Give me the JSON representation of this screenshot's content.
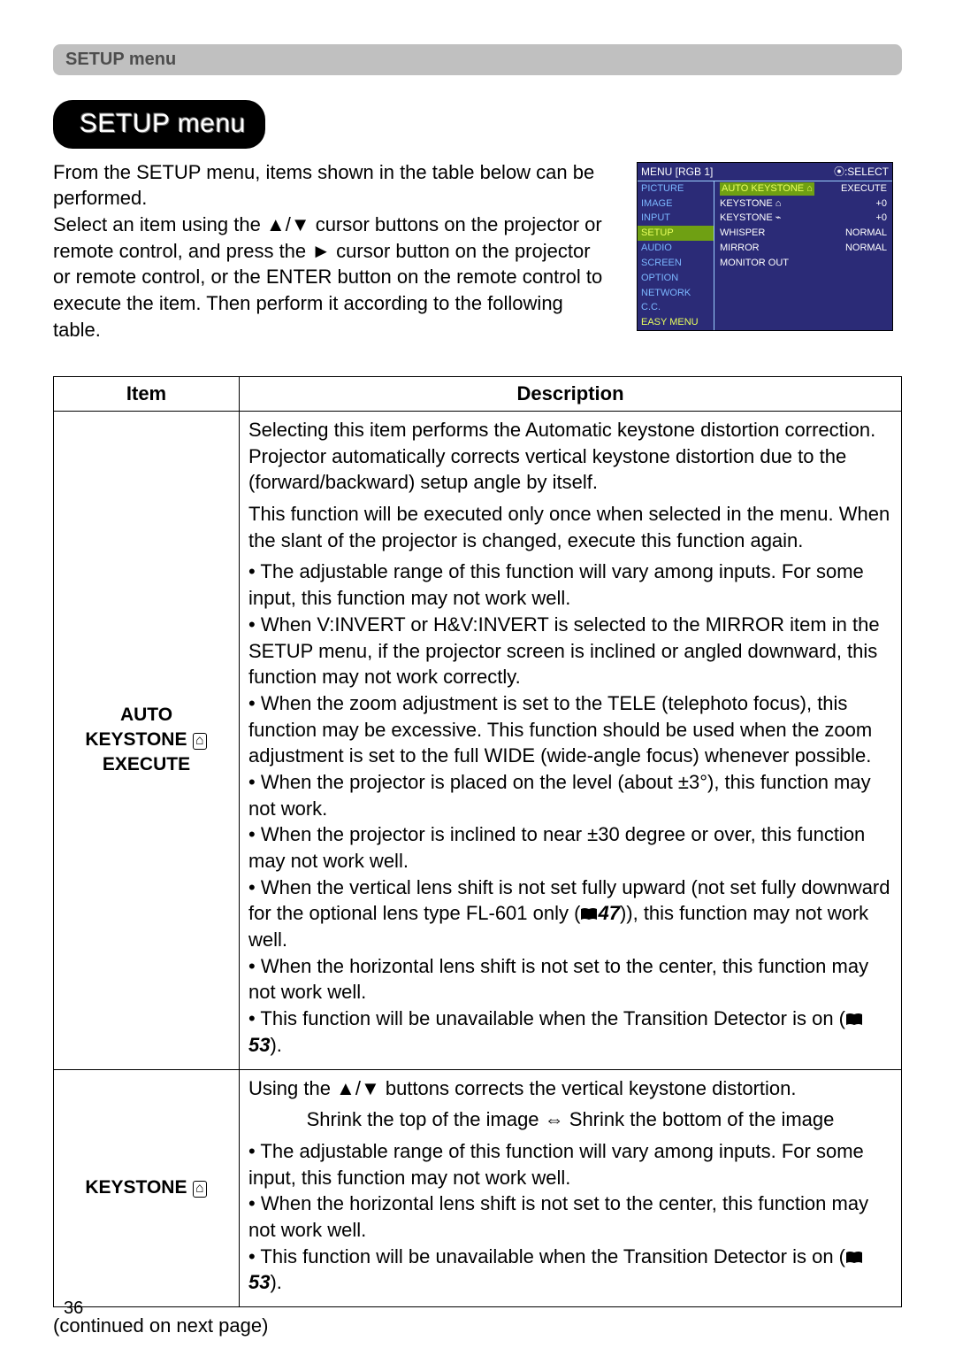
{
  "header": {
    "label": "SETUP menu"
  },
  "title": "SETUP menu",
  "intro": {
    "text_lines": [
      "From the SETUP menu, items shown in the table below can be performed.",
      "Select an item using the ▲/▼ cursor buttons on the projector or remote control, and press the ► cursor button on the projector or remote control, or the ENTER button on the remote control to execute the item. Then perform it according to the following table."
    ]
  },
  "menu_screenshot": {
    "head_left": "MENU [RGB 1]",
    "head_right": "⦿:SELECT",
    "sidebar": [
      {
        "label": "PICTURE"
      },
      {
        "label": "IMAGE"
      },
      {
        "label": "INPUT"
      },
      {
        "label": "SETUP",
        "selected": true
      },
      {
        "label": "AUDIO"
      },
      {
        "label": "SCREEN"
      },
      {
        "label": "OPTION"
      },
      {
        "label": "NETWORK"
      },
      {
        "label": "C.C."
      },
      {
        "label": "EASY MENU",
        "easy": true
      }
    ],
    "main_rows": [
      {
        "label": "AUTO KEYSTONE ⌂",
        "value": "EXECUTE",
        "selected": true
      },
      {
        "label": "KEYSTONE ⌂",
        "value": "+0"
      },
      {
        "label": "KEYSTONE ⌁",
        "value": "+0"
      },
      {
        "label": "WHISPER",
        "value": "NORMAL"
      },
      {
        "label": "MIRROR",
        "value": "NORMAL"
      },
      {
        "label": "MONITOR OUT",
        "value": ""
      }
    ]
  },
  "table": {
    "headers": {
      "item": "Item",
      "description": "Description"
    },
    "rows": [
      {
        "item_lines": [
          "AUTO",
          "KEYSTONE ",
          "EXECUTE"
        ],
        "item_icon": "trapezoid-v",
        "desc_p1": "Selecting this item performs the Automatic keystone distortion correction. Projector automatically corrects vertical keystone distortion due to the (forward/backward) setup angle by itself.",
        "desc_p2": "This function will be executed only once when selected in the menu. When the slant of the projector is changed, execute this function again.",
        "bullets": [
          "The adjustable range of this function will vary among inputs. For some input, this function may not work well.",
          "When V:INVERT or H&V:INVERT is selected to the MIRROR item in the SETUP menu, if the projector screen is inclined or angled downward, this function may not work correctly.",
          "When the zoom adjustment is set to the TELE (telephoto focus), this function may be excessive. This function should be used when the zoom adjustment is set to the full WIDE (wide-angle focus) whenever possible.",
          "When the projector is placed on the level (about ±3°), this function may not work.",
          "When the projector is inclined to near ±30 degree or over, this function may not work well."
        ],
        "bullet_ref47_pre": "When the vertical lens shift is not set fully upward (not set fully downward for the optional lens type FL-601 only (",
        "bullet_ref47_num": "47",
        "bullet_ref47_post": ")), this function may not work well.",
        "bullet_after47": "When the horizontal lens shift is not set to the center, this function may not work well.",
        "bullet_ref53_pre": "This function will be unavailable when the Transition Detector is on (",
        "bullet_ref53_num": "53",
        "bullet_ref53_post": ")."
      },
      {
        "item_lines": [
          "KEYSTONE "
        ],
        "item_icon": "trapezoid-v",
        "desc_p1": "Using the ▲/▼ buttons corrects the vertical keystone distortion.",
        "desc_center": "Shrink the top of the image ⇔ Shrink the bottom of the image",
        "bullets": [
          "The adjustable range of this function will vary among inputs. For some input, this function may not work well.",
          "When the horizontal lens shift is not set to the center, this function may not work well."
        ],
        "bullet_ref53_pre": "This function will be unavailable when the Transition Detector is on (",
        "bullet_ref53_num": "53",
        "bullet_ref53_post": ")."
      }
    ]
  },
  "continued": "(continued on next page)",
  "page_number": "36"
}
